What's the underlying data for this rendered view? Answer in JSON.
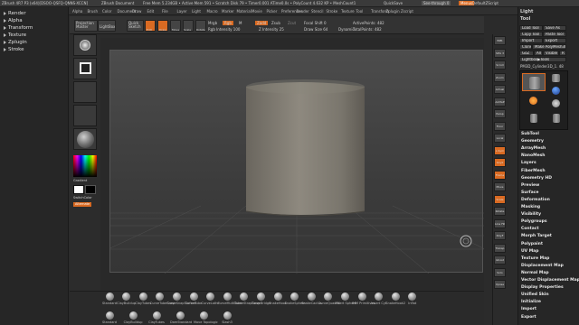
{
  "titlebar": {
    "app": "ZBrush 4R7 P3 (x64)[DSOO-QSFQ-QNNS-XCCN]",
    "doc": "ZBrush Document",
    "stats": "Free Mem 5.234GB • Active Mem 591 • Scratch Disk 79 • Timer0.001 ATime0.0s • PolyCount 4.632 KP • MeshCount1",
    "quicksave": "QuickSave",
    "seethrough": "See-through 0",
    "menus": "Menus",
    "default_script": "DefaultZScript"
  },
  "menubar": [
    "Alpha",
    "Brush",
    "Color",
    "Document",
    "Draw",
    "Edit",
    "File",
    "Layer",
    "Light",
    "Macro",
    "Marker",
    "Material",
    "Movie",
    "Picker",
    "Preferences",
    "Render",
    "Stencil",
    "Stroke",
    "Texture",
    "Tool",
    "Transform",
    "Zplugin",
    "Zscript"
  ],
  "left_palette": [
    "Render",
    "Alpha",
    "Transform",
    "Texture",
    "Zplugin",
    "Stroke"
  ],
  "toptools": {
    "projection_master": "Projection Master",
    "lightbox": "LightBox",
    "quick_sketch": "Quick Sketch",
    "edit": "Edit",
    "draw": "Draw",
    "move": "Move",
    "scale": "Scale",
    "rotate": "Rotate",
    "mrgb": "Mrgb",
    "rgb": "Rgb",
    "m": "M",
    "rgb_intensity": "Rgb Intensity 100",
    "zadd": "Zadd",
    "zsub": "Zsub",
    "zcut": "Zcut",
    "z_intensity": "Z Intensity 25",
    "focal_shift": "Focal Shift 0",
    "draw_size": "Draw Size 64",
    "dynamic": "Dynamic",
    "active_points": "ActivePoints: 482",
    "total_points": "TotalPoints: 482"
  },
  "left_shelf": {
    "gradient": "Gradient",
    "switch_color": "SwitchColor",
    "alternate": "Alternate"
  },
  "bottom_shelf": [
    "Standard",
    "ClayBuildup",
    "ClayTubes",
    "CurveTubeSnap",
    "CurveSnapSurface",
    "CurveTube",
    "CurveLathe",
    "CurveMultiTube",
    "CurveStrapSnap",
    "CurveBridge",
    "SnakeHook",
    "SnakeSphere",
    "SnakeCactus",
    "CurveQuadFill",
    "Insert Sphere",
    "IMM Primitives",
    "Insert Cyl",
    "SnakeHook2",
    "Inflat"
  ],
  "bottom_shelf_row2": [
    "Standard",
    "ClayBuildup",
    "ClayTubes",
    "DamStandard",
    "Move Topologic",
    "Slash3"
  ],
  "right_shelf": [
    "BPR",
    "SPix 3",
    "Scroll",
    "Zoom",
    "Actual",
    "AAHalf",
    "Persp",
    "Floor",
    "Local",
    "L.Sym",
    "Gxyz",
    "Frame",
    "Move",
    "Scale",
    "Rotate",
    "Line Fill",
    "PolyF",
    "Transp",
    "Ghost",
    "Solo",
    "Xpose"
  ],
  "right_tray": {
    "light": "Light",
    "tool": "Tool",
    "load_tool": "Load Tool",
    "save_as": "Save As",
    "copy_tool": "Copy Tool",
    "paste_tool": "Paste Tool",
    "import": "Import",
    "export": "Export",
    "clone": "Clone",
    "make_polymesh": "Make PolyMesh3D",
    "goz": "GoZ",
    "all": "All",
    "visible": "Visible",
    "r": "R",
    "lightbox_tools": "Lightbox▶Tools",
    "current_tool": "PM3D_Cylinder3D_1. 48",
    "tool_names": [
      "PM3D_Cylinder3D",
      "Cylinder3D",
      "PolyMesh3D",
      "SimpleBrush",
      "EraserBrush",
      "Cylinder3D_1"
    ],
    "subpalettes": [
      "SubTool",
      "Geometry",
      "ArrayMesh",
      "NanoMesh",
      "Layers",
      "FiberMesh",
      "Geometry HD",
      "Preview",
      "Surface",
      "Deformation",
      "Masking",
      "Visibility",
      "Polygroups",
      "Contact",
      "Morph Target",
      "Polypaint",
      "UV Map",
      "Texture Map",
      "Displacement Map",
      "Normal Map",
      "Vector Displacement Map",
      "Display Properties",
      "Unified Skin",
      "Initialize",
      "Import",
      "Export"
    ]
  },
  "colors": {
    "accent": "#d96a22",
    "bg": "#2b2b2b",
    "panel": "#262626"
  }
}
